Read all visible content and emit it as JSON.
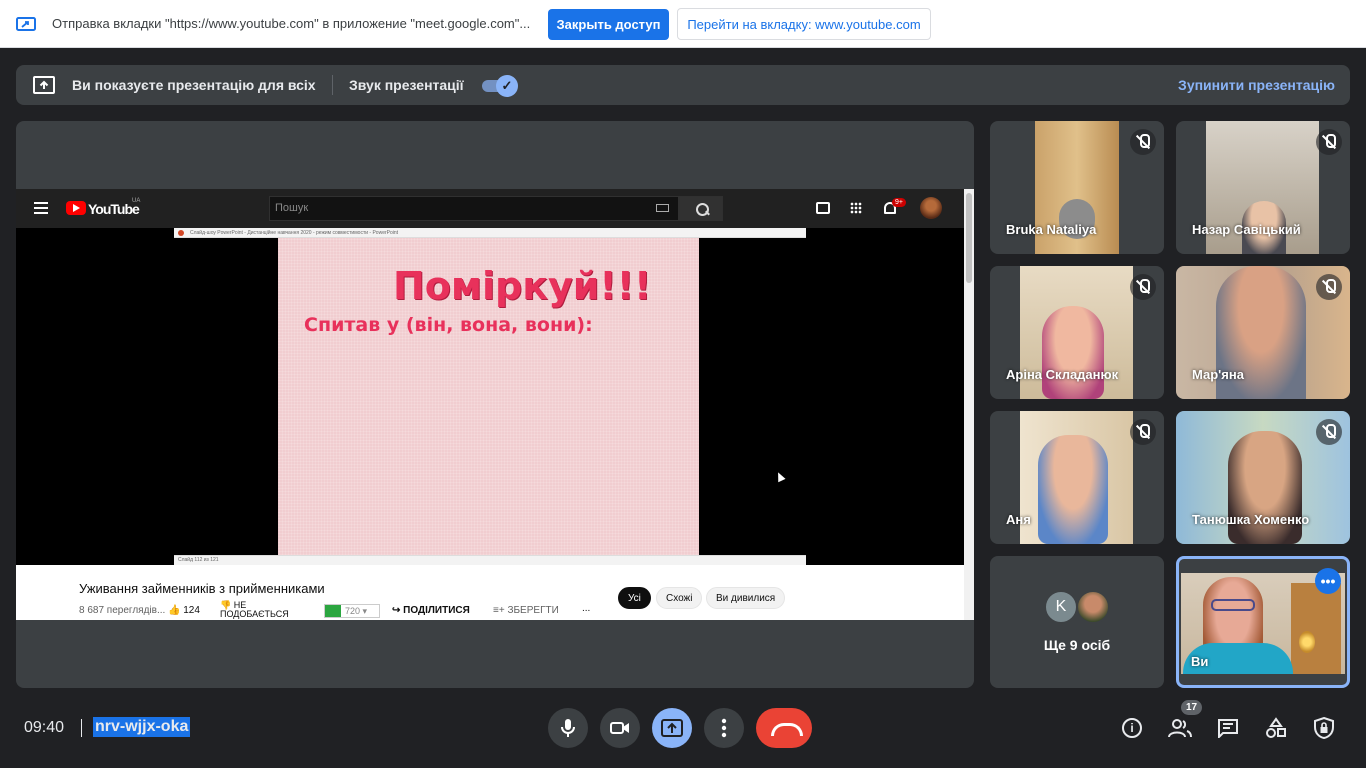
{
  "infobar": {
    "message": "Отправка вкладки \"https://www.youtube.com\" в приложение \"meet.google.com\"...",
    "close_access_label": "Закрыть доступ",
    "goto_tab_label": "Перейти на вкладку: www.youtube.com"
  },
  "present_bar": {
    "presenting_text": "Ви показуєте презентацію для всіх",
    "sound_label": "Звук презентації",
    "sound_enabled": true,
    "stop_label": "Зупинити презентацію"
  },
  "youtube": {
    "logo_text": "YouTube",
    "region": "UA",
    "search_placeholder": "Пошук",
    "notifications_badge": "9+",
    "ppt_window_title": "Слайд-шоу PowerPoint - Дистанційне навчання 2020 - режим совместимости - PowerPoint",
    "ppt_status": "Слайд 112 из 121",
    "slide_title": "Поміркуй!!!",
    "slide_subtitle": "Спитав у (він, вона, вони):",
    "video_title": "Уживання займенників з прийменниками",
    "views": "8 687 переглядів...",
    "likes": "124",
    "dislike_label": "НЕ ПОДОБАЄТЬСЯ",
    "quality": "720",
    "share_label": "ПОДІЛИТИСЯ",
    "save_label": "ЗБЕРЕГТИ",
    "more": "...",
    "chips": [
      "Усі",
      "Схожі",
      "Ви дивилися"
    ]
  },
  "participants": [
    {
      "name": "Bruka Nataliya",
      "muted": true
    },
    {
      "name": "Назар Савіцький",
      "muted": true
    },
    {
      "name": "Аріна Складанюк",
      "muted": true
    },
    {
      "name": "Мар'яна",
      "muted": true
    },
    {
      "name": "Аня",
      "muted": true
    },
    {
      "name": "Танюшка Хоменко",
      "muted": true
    }
  ],
  "more_participants": {
    "avatar_letter": "K",
    "label": "Ще 9 осіб"
  },
  "self_tile": {
    "name": "Ви"
  },
  "bottom_bar": {
    "time": "09:40",
    "meeting_code": "nrv-wjjx-oka",
    "people_count": "17"
  },
  "colors": {
    "accent": "#1a73e8",
    "end_call": "#ea4335",
    "background": "#202124",
    "tile": "#3c4043",
    "slide_text": "#e8315b"
  }
}
